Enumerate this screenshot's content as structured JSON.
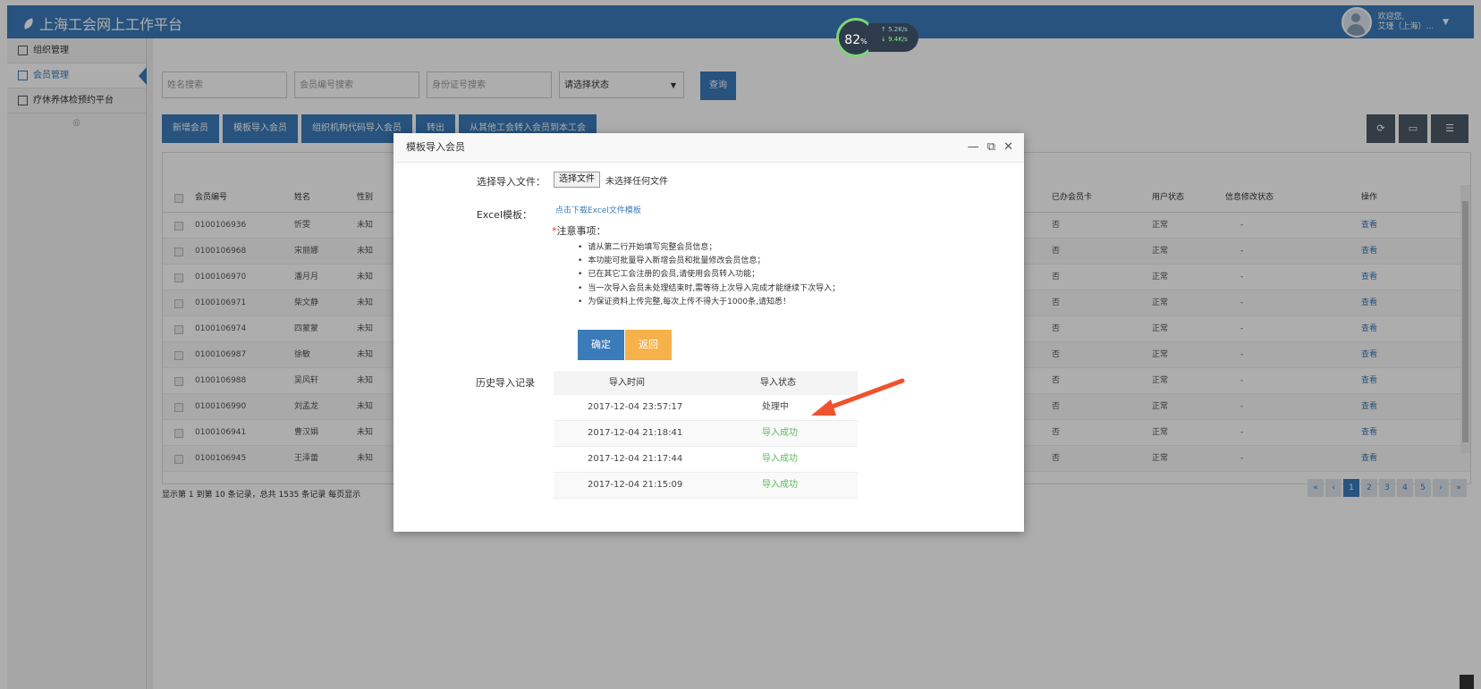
{
  "app": {
    "title": "上海工会网上工作平台",
    "user_greeting": "欢迎您,",
    "user_name": "艾瑾（上海）..."
  },
  "speed_widget": {
    "percent": "82",
    "unit": "%",
    "up": "5.2K/s",
    "down": "9.4K/s"
  },
  "sidebar": {
    "items": [
      {
        "label": "组织管理"
      },
      {
        "label": "会员管理"
      },
      {
        "label": "疗休养体检预约平台"
      }
    ]
  },
  "search": {
    "name_placeholder": "姓名搜索",
    "member_no_placeholder": "会员编号搜索",
    "id_placeholder": "身份证号搜索",
    "status_placeholder": "请选择状态",
    "query_label": "查询"
  },
  "toolbar": {
    "buttons": [
      "新增会员",
      "模板导入会员",
      "组织机构代码导入会员",
      "转出",
      "从其他工会转入会员到本工会"
    ]
  },
  "table": {
    "headers": {
      "member_no": "会员编号",
      "name": "姓名",
      "gender": "性别",
      "card": "已办会员卡",
      "user_status": "用户状态",
      "info_status": "信息修改状态",
      "op": "操作"
    },
    "rows": [
      {
        "member_no": "0100106936",
        "name": "忻雯",
        "gender": "未知",
        "card": "否",
        "user_status": "正常",
        "info_status": "-",
        "op": "查看"
      },
      {
        "member_no": "0100106968",
        "name": "宋丽娜",
        "gender": "未知",
        "card": "否",
        "user_status": "正常",
        "info_status": "-",
        "op": "查看"
      },
      {
        "member_no": "0100106970",
        "name": "潘月月",
        "gender": "未知",
        "card": "否",
        "user_status": "正常",
        "info_status": "-",
        "op": "查看"
      },
      {
        "member_no": "0100106971",
        "name": "柴文静",
        "gender": "未知",
        "card": "否",
        "user_status": "正常",
        "info_status": "-",
        "op": "查看"
      },
      {
        "member_no": "0100106974",
        "name": "四蒙蒙",
        "gender": "未知",
        "card": "否",
        "user_status": "正常",
        "info_status": "-",
        "op": "查看"
      },
      {
        "member_no": "0100106987",
        "name": "徐敏",
        "gender": "未知",
        "card": "否",
        "user_status": "正常",
        "info_status": "-",
        "op": "查看"
      },
      {
        "member_no": "0100106988",
        "name": "吴风轩",
        "gender": "未知",
        "card": "否",
        "user_status": "正常",
        "info_status": "-",
        "op": "查看"
      },
      {
        "member_no": "0100106990",
        "name": "刘孟龙",
        "gender": "未知",
        "card": "否",
        "user_status": "正常",
        "info_status": "-",
        "op": "查看"
      },
      {
        "member_no": "0100106941",
        "name": "曹汉娟",
        "gender": "未知",
        "card": "否",
        "user_status": "正常",
        "info_status": "-",
        "op": "查看"
      },
      {
        "member_no": "0100106945",
        "name": "王泽蕾",
        "gender": "未知",
        "card": "否",
        "user_status": "正常",
        "info_status": "-",
        "op": "查看"
      }
    ]
  },
  "footer": {
    "summary": "显示第 1 到第 10 条记录，总共 1535 条记录 每页显示"
  },
  "pager": {
    "pages": [
      "«",
      "‹",
      "1",
      "2",
      "3",
      "4",
      "5",
      "›",
      "»"
    ]
  },
  "modal": {
    "title": "模板导入会员",
    "file_label": "选择导入文件：",
    "file_button": "选择文件",
    "file_status": "未选择任何文件",
    "template_label": "Excel模板：",
    "template_link": "点击下载Excel文件模板",
    "notice_star": "*",
    "notice_title": "注意事项：",
    "notes": [
      "请从第二行开始填写完整会员信息；",
      "本功能可批量导入新增会员和批量修改会员信息；",
      "已在其它工会注册的会员,请使用会员转入功能；",
      "当一次导入会员未处理结束时,需等待上次导入完成才能继续下次导入；",
      "为保证资料上传完整,每次上传不得大于1000条,请知悉！"
    ],
    "ok_label": "确定",
    "back_label": "返回",
    "history_label": "历史导入记录",
    "history_headers": {
      "time": "导入时间",
      "status": "导入状态"
    },
    "history": [
      {
        "time": "2017-12-04 23:57:17",
        "status": "处理中"
      },
      {
        "time": "2017-12-04 21:18:41",
        "status": "导入成功"
      },
      {
        "time": "2017-12-04 21:17:44",
        "status": "导入成功"
      },
      {
        "time": "2017-12-04 21:15:09",
        "status": "导入成功"
      }
    ]
  },
  "colors": {
    "primary": "#3a7bba",
    "warning": "#f6b14a",
    "success": "#5cb85c",
    "arrow": "#f0522e"
  }
}
